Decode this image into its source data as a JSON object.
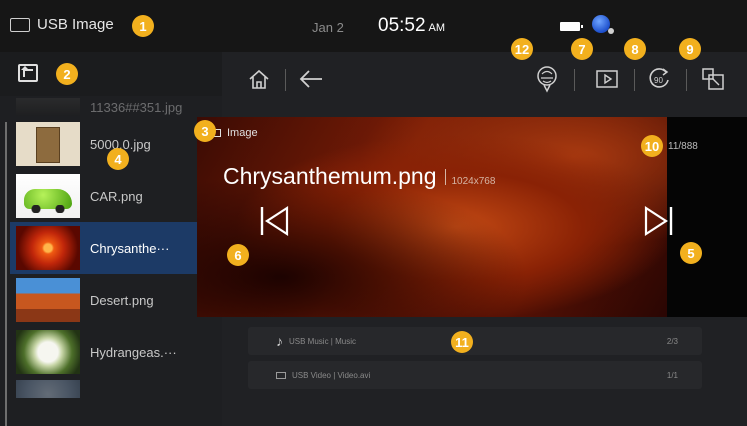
{
  "status_bar": {
    "source_label": "USB Image",
    "date": "Jan 2",
    "time": "05:52",
    "ampm": "AM"
  },
  "file_list": {
    "items": [
      {
        "name": "11336##351.jpg",
        "thumb": "dark",
        "partial": true
      },
      {
        "name": "5000.0.jpg",
        "thumb": "book"
      },
      {
        "name": "CAR.png",
        "thumb": "car"
      },
      {
        "name": "Chrysanthe···",
        "thumb": "flower",
        "selected": true
      },
      {
        "name": "Desert.png",
        "thumb": "desert"
      },
      {
        "name": "Hydrangeas.···",
        "thumb": "hydrangea"
      },
      {
        "name": "",
        "thumb": "blue",
        "partial": true
      }
    ]
  },
  "viewer": {
    "folder": "Image",
    "filename": "Chrysanthemum.png",
    "resolution": "1024x768",
    "counter": "11/888"
  },
  "background_lists": [
    {
      "label": "USB Music | Music",
      "count": "2/3"
    },
    {
      "label": "USB Video | Video.avi",
      "count": "1/1"
    }
  ],
  "callouts": [
    "1",
    "2",
    "3",
    "4",
    "5",
    "6",
    "7",
    "8",
    "9",
    "10",
    "11",
    "12"
  ],
  "icons": {
    "up_folder": "up-folder-icon",
    "home": "home-icon",
    "back": "back-arrow-icon",
    "map": "map-pin-icon",
    "slideshow": "slideshow-icon",
    "rotate": "rotate-90-icon",
    "resize": "resize-icon",
    "prev": "previous-icon",
    "next": "next-icon"
  },
  "colors": {
    "selected_row": "#1c3a66",
    "callout": "#f2b01e"
  }
}
